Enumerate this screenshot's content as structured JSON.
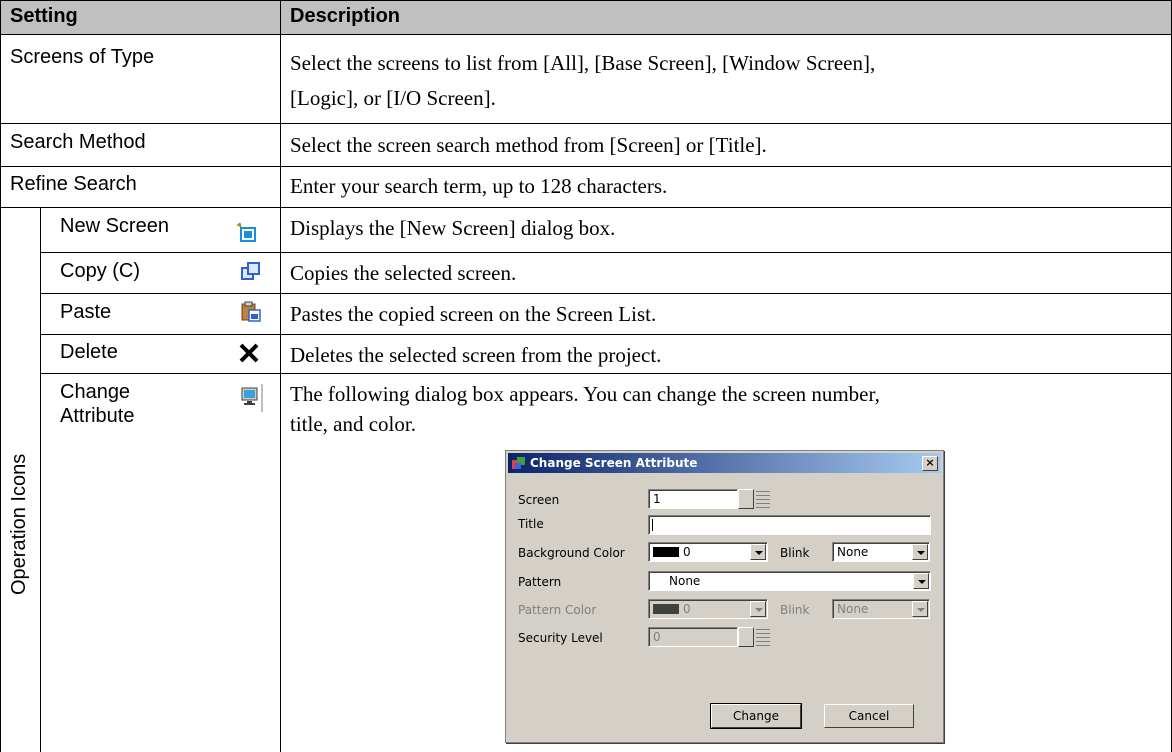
{
  "table": {
    "header": {
      "setting": "Setting",
      "description": "Description"
    },
    "rows": [
      {
        "setting": "Screens of Type",
        "description_line1": "Select the screens to list from [All], [Base Screen], [Window Screen],",
        "description_line2": "[Logic], or [I/O Screen]."
      },
      {
        "setting": "Search Method",
        "description": "Select the screen search method from [Screen] or [Title]."
      },
      {
        "setting": "Refine Search",
        "description": "Enter your search term, up to 128 characters."
      }
    ],
    "group_label": "Operation Icons",
    "icon_rows": [
      {
        "label": "New Screen",
        "icon": "new-screen-icon",
        "description": "Displays the [New Screen] dialog box."
      },
      {
        "label": "Copy (C)",
        "icon": "copy-icon",
        "description": "Copies the selected screen."
      },
      {
        "label": "Paste",
        "icon": "paste-icon",
        "description": "Pastes the copied screen on the Screen List."
      },
      {
        "label": "Delete",
        "icon": "delete-icon",
        "description": "Deletes the selected screen from the project."
      },
      {
        "label_line1": "Change",
        "label_line2": "Attribute",
        "icon": "change-attribute-icon",
        "description_line1": "The following dialog box appears. You can change the screen number,",
        "description_line2": "title, and color."
      }
    ]
  },
  "dialog": {
    "title": "Change Screen Attribute",
    "close": "×",
    "screen_label": "Screen",
    "screen_value": "1",
    "title_label": "Title",
    "title_value": "",
    "bg_color_label": "Background Color",
    "bg_color_value": "0",
    "blink_label": "Blink",
    "blink_value": "None",
    "pattern_label": "Pattern",
    "pattern_value": "None",
    "pattern_color_label": "Pattern Color",
    "pattern_color_value": "0",
    "blink2_label": "Blink",
    "blink2_value": "None",
    "security_label": "Security Level",
    "security_value": "0",
    "change_button": "Change",
    "cancel_button": "Cancel"
  },
  "colors": {
    "header_bg": "#c0c0c0",
    "title_bar": "#0a246a",
    "dialog_bg": "#d4d0c8"
  }
}
